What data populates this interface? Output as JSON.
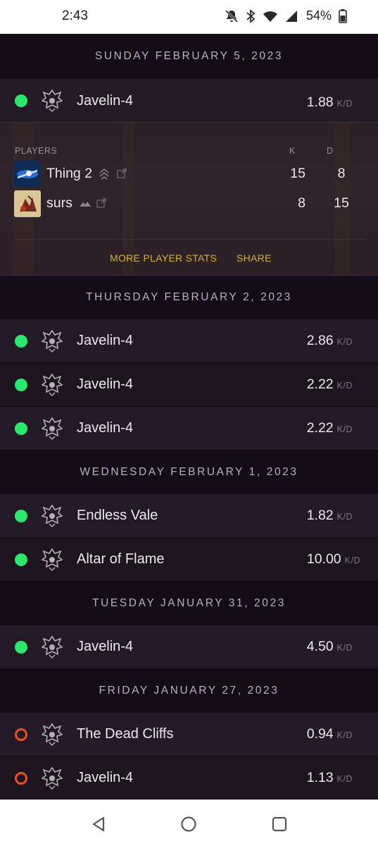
{
  "status_bar": {
    "time": "2:43",
    "battery": "54%",
    "icons": [
      "notifications-off-icon",
      "bluetooth-icon",
      "wifi-icon",
      "signal-icon",
      "battery-icon"
    ]
  },
  "labels": {
    "kd_unit": "K/D",
    "players": "PLAYERS",
    "k": "K",
    "d": "D",
    "more_stats": "MORE PLAYER STATS",
    "share": "SHARE"
  },
  "colors": {
    "win": "#2ee66d",
    "loss": "#e8502a",
    "action": "#d8b431"
  },
  "groups": [
    {
      "date": "SUNDAY FEBRUARY 5, 2023",
      "games": [
        {
          "map": "Javelin-4",
          "kd": "1.88",
          "result": "win",
          "expanded": true,
          "players": [
            {
              "name": "Thing 2",
              "kills": "15",
              "deaths": "8",
              "rank_icon": "rank-chevrons-icon"
            },
            {
              "name": "surs",
              "kills": "8",
              "deaths": "15",
              "rank_icon": "rank-mountain-icon"
            }
          ]
        }
      ]
    },
    {
      "date": "THURSDAY FEBRUARY 2, 2023",
      "games": [
        {
          "map": "Javelin-4",
          "kd": "2.86",
          "result": "win"
        },
        {
          "map": "Javelin-4",
          "kd": "2.22",
          "result": "win"
        },
        {
          "map": "Javelin-4",
          "kd": "2.22",
          "result": "win"
        }
      ]
    },
    {
      "date": "WEDNESDAY FEBRUARY 1, 2023",
      "games": [
        {
          "map": "Endless Vale",
          "kd": "1.82",
          "result": "win"
        },
        {
          "map": "Altar of Flame",
          "kd": "10.00",
          "result": "win"
        }
      ]
    },
    {
      "date": "TUESDAY JANUARY 31, 2023",
      "games": [
        {
          "map": "Javelin-4",
          "kd": "4.50",
          "result": "win"
        }
      ]
    },
    {
      "date": "FRIDAY JANUARY 27, 2023",
      "games": [
        {
          "map": "The Dead Cliffs",
          "kd": "0.94",
          "result": "loss"
        },
        {
          "map": "Javelin-4",
          "kd": "1.13",
          "result": "loss"
        }
      ]
    }
  ]
}
